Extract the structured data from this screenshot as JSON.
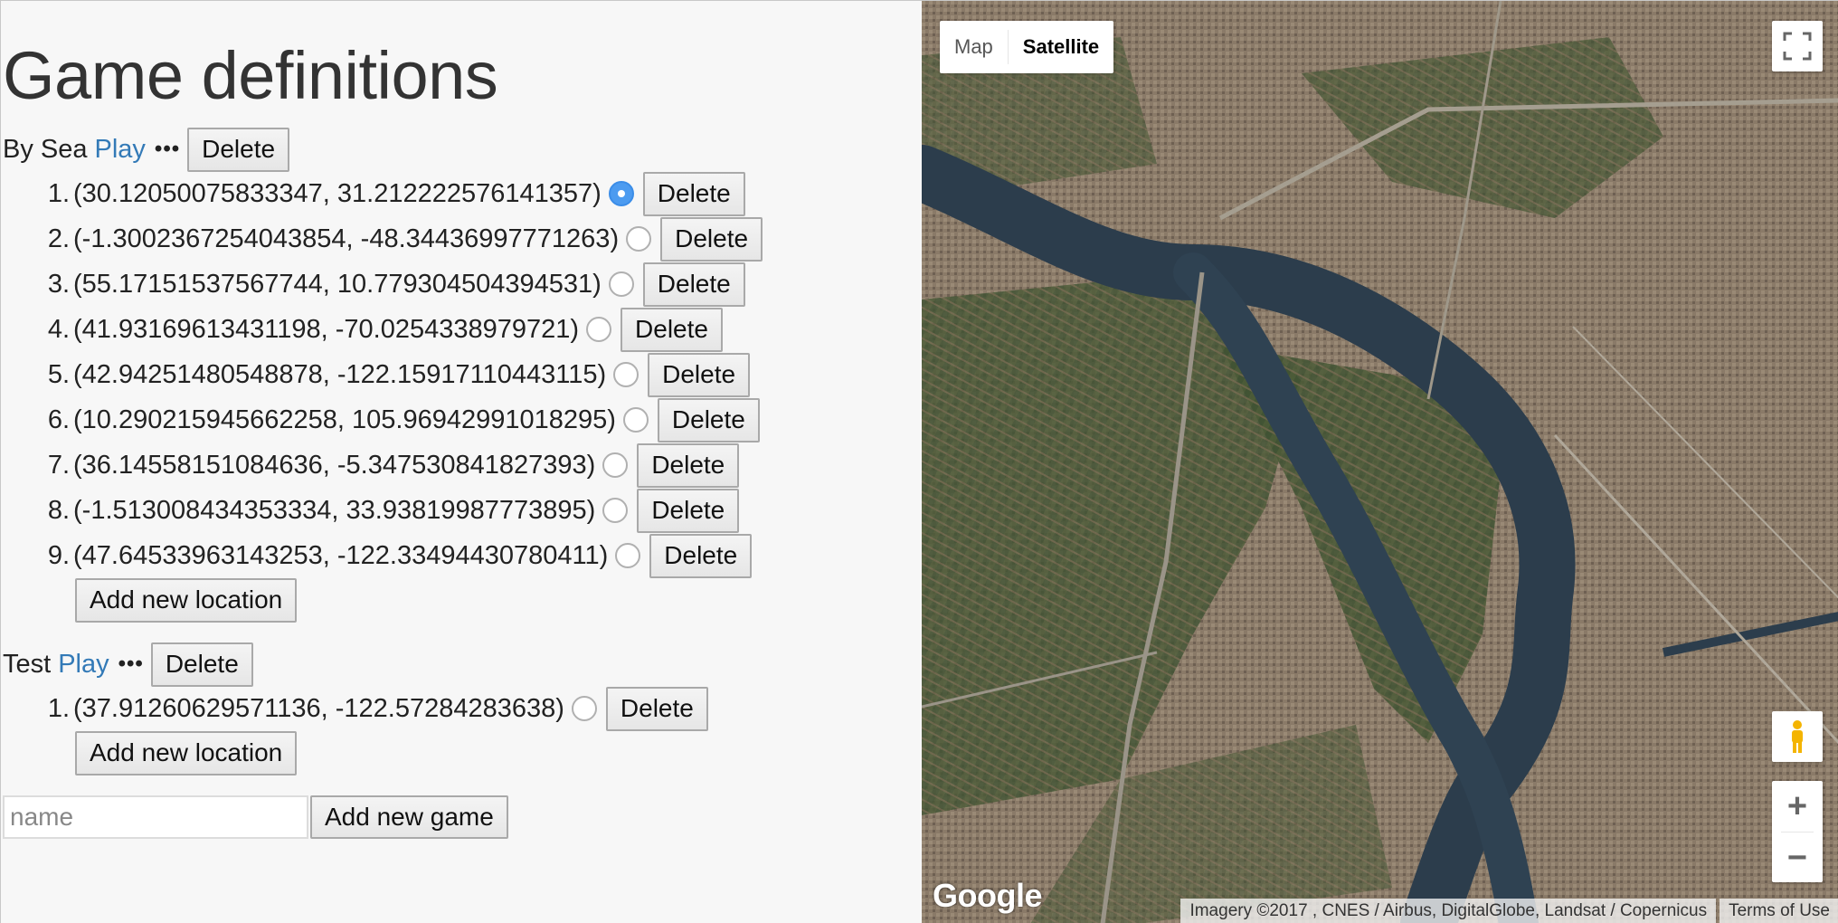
{
  "page": {
    "title": "Game definitions"
  },
  "games": [
    {
      "name": "By Sea",
      "play_label": "Play",
      "more_label": "•••",
      "delete_label": "Delete",
      "locations": [
        {
          "num": "1.",
          "coords": "(30.12050075833347, 31.212222576141357)",
          "selected": true,
          "delete_label": "Delete"
        },
        {
          "num": "2.",
          "coords": "(-1.3002367254043854, -48.34436997771263)",
          "selected": false,
          "delete_label": "Delete"
        },
        {
          "num": "3.",
          "coords": "(55.17151537567744, 10.779304504394531)",
          "selected": false,
          "delete_label": "Delete"
        },
        {
          "num": "4.",
          "coords": "(41.93169613431198, -70.0254338979721)",
          "selected": false,
          "delete_label": "Delete"
        },
        {
          "num": "5.",
          "coords": "(42.94251480548878, -122.15917110443115)",
          "selected": false,
          "delete_label": "Delete"
        },
        {
          "num": "6.",
          "coords": "(10.290215945662258, 105.96942991018295)",
          "selected": false,
          "delete_label": "Delete"
        },
        {
          "num": "7.",
          "coords": "(36.14558151084636, -5.347530841827393)",
          "selected": false,
          "delete_label": "Delete"
        },
        {
          "num": "8.",
          "coords": "(-1.513008434353334, 33.93819987773895)",
          "selected": false,
          "delete_label": "Delete"
        },
        {
          "num": "9.",
          "coords": "(47.64533963143253, -122.33494430780411)",
          "selected": false,
          "delete_label": "Delete"
        }
      ],
      "add_location_label": "Add new location"
    },
    {
      "name": "Test",
      "play_label": "Play",
      "more_label": "•••",
      "delete_label": "Delete",
      "locations": [
        {
          "num": "1.",
          "coords": "(37.91260629571136, -122.57284283638)",
          "selected": false,
          "delete_label": "Delete"
        }
      ],
      "add_location_label": "Add new location"
    }
  ],
  "new_game": {
    "input_value": "",
    "placeholder": "name",
    "button_label": "Add new game"
  },
  "map": {
    "type_map_label": "Map",
    "type_satellite_label": "Satellite",
    "active_type": "Satellite",
    "zoom_in_label": "+",
    "zoom_out_label": "−",
    "logo": "Google",
    "attribution": "Imagery ©2017 , CNES / Airbus, DigitalGlobe, Landsat / Copernicus",
    "terms_label": "Terms of Use",
    "icons": [
      "fullscreen-icon",
      "pegman-icon"
    ]
  }
}
